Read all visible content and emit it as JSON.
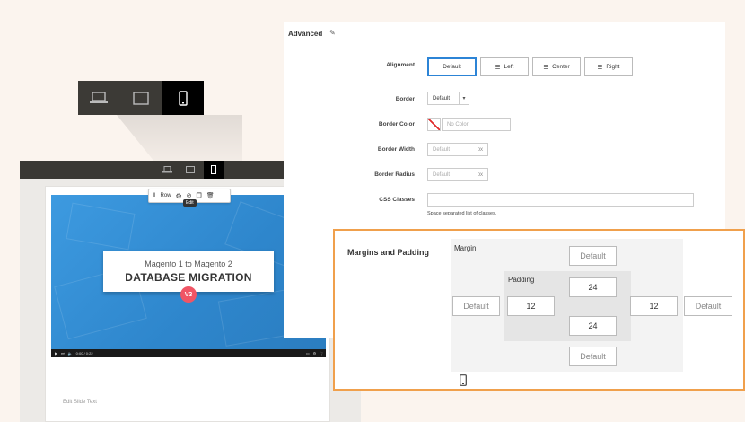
{
  "device_switcher": {
    "devices": [
      {
        "name": "desktop",
        "icon": "desktop-icon"
      },
      {
        "name": "tablet",
        "icon": "tablet-icon"
      },
      {
        "name": "mobile",
        "icon": "mobile-icon",
        "active": true
      }
    ]
  },
  "editor": {
    "row_toolbar": {
      "label": "Row",
      "tooltip": "Edit"
    },
    "video": {
      "line1": "Magento 1 to Magento 2",
      "line2": "DATABASE MIGRATION",
      "badge": "V3",
      "time": "0:00 / 0:22"
    },
    "slide_text": "Edit Slide Text"
  },
  "advanced": {
    "title": "Advanced",
    "alignment": {
      "label": "Alignment",
      "options": [
        "Default",
        "Left",
        "Center",
        "Right"
      ],
      "selected": "Default"
    },
    "border": {
      "label": "Border",
      "value": "Default"
    },
    "border_color": {
      "label": "Border Color",
      "placeholder": "No Color"
    },
    "border_width": {
      "label": "Border Width",
      "placeholder": "Default",
      "unit": "px"
    },
    "border_radius": {
      "label": "Border Radius",
      "placeholder": "Default",
      "unit": "px"
    },
    "css_classes": {
      "label": "CSS Classes",
      "value": "",
      "help": "Space separated list of classes."
    }
  },
  "margins_padding": {
    "title": "Margins and Padding",
    "margin_label": "Margin",
    "padding_label": "Padding",
    "margin": {
      "top": "Default",
      "right": "Default",
      "bottom": "Default",
      "left": "Default"
    },
    "padding": {
      "top": "24",
      "right": "12",
      "bottom": "24",
      "left": "12"
    }
  },
  "colors": {
    "accent": "#2c84d6",
    "highlight": "#f0a04c",
    "badge": "#f05565"
  }
}
